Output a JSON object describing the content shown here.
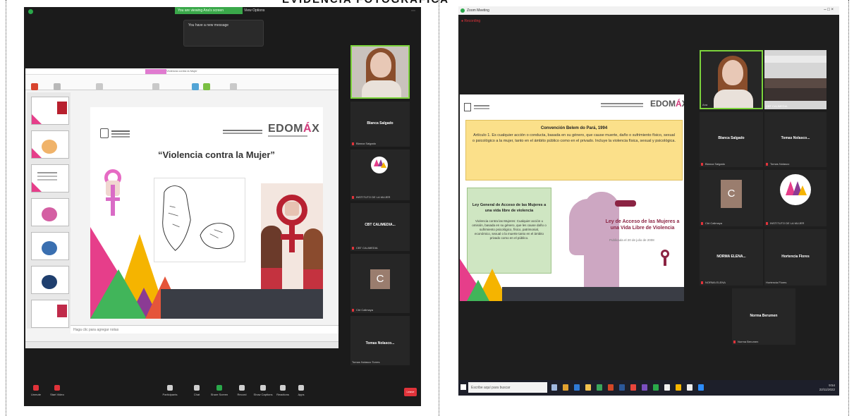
{
  "document_title": "EVIDENCIA FOTOGRÁFICA",
  "left": {
    "zoom_banner": "You are viewing Ana's screen",
    "view_options": "View Options",
    "notification": "You have a new message",
    "ppt_title": "Violencia contra la Mujer",
    "slide": {
      "title": "“Violencia contra la Mujer”",
      "brand": "EDOMEX",
      "brand_accent": "Á"
    },
    "notes_placeholder": "Haga clic para agregar notas",
    "participants": [
      {
        "name": "Blanca Salgado",
        "caption": "Blanca Salgado"
      },
      {
        "name": "",
        "caption": "INSTITUTO DE LA MUJER"
      },
      {
        "name": "CBT CALIMEDIA...",
        "caption": "CBT CALIMEDIA"
      },
      {
        "name": "",
        "caption": "Cbt Calimaya"
      },
      {
        "name": "Tomas Nolasco...",
        "caption": "Tomas Nolasco Torres"
      }
    ],
    "toolbar": [
      {
        "label": "Unmute"
      },
      {
        "label": "Start Video"
      },
      {
        "label": "Participants"
      },
      {
        "label": "Chat"
      },
      {
        "label": "Share Screen"
      },
      {
        "label": "Record"
      },
      {
        "label": "Show Captions"
      },
      {
        "label": "Reactions"
      },
      {
        "label": "Apps"
      }
    ],
    "end_label": "Leave"
  },
  "right": {
    "window_title": "Zoom Meeting",
    "window_controls": "–  □  ×",
    "recording": "● Recording",
    "slide": {
      "brand": "EDOMEX",
      "brand_accent": "Á",
      "convention_title": "Convención Belem do Pará, 1994",
      "convention_text": "Artículo 1. Es cualquier acción o conducta, basada en su género, que cause muerte, daño o sufrimiento físico, sexual o psicológico a la mujer, tanto en el ámbito público como en el privado. Incluye la violencia física, sexual y psicológica.",
      "ley_title": "Ley General de Acceso de las Mujeres a una vida libre de violencia",
      "ley_text": "Violencia contra las Mujeres: Cualquier acción u omisión, basada en su género, que les cause daño o sufrimiento psicológico, físico, patrimonial, económico, sexual o la muerte tanto en el ámbito privado como en el público.",
      "ley2_title": "Ley de Acceso de las Mujeres a una Vida Libre de Violencia",
      "ley2_date": "Publicada el 20 de julio de 2008"
    },
    "participants": [
      {
        "name": "",
        "caption": "Ana"
      },
      {
        "name": "",
        "caption": "CBT CALIMEDIA"
      },
      {
        "name": "Blanca Salgado",
        "caption": "Blanca Salgado"
      },
      {
        "name": "Tomas Nolasco...",
        "caption": "Tomas Nolasco"
      },
      {
        "name": "C",
        "caption": "Cbt Calimaya"
      },
      {
        "name": "",
        "caption": "INSTITUTO DE LA MUJER"
      },
      {
        "name": "NORMA ELENA...",
        "caption": "NORMA ELENA"
      },
      {
        "name": "Hortencia Flores",
        "caption": "Hortencia Flores"
      },
      {
        "name": "Norma Berumen",
        "caption": "Norma Berumen"
      }
    ],
    "taskbar": {
      "search_placeholder": "Escribe aquí para buscar",
      "tray_time": "9:54",
      "tray_date": "22/11/2022"
    }
  }
}
